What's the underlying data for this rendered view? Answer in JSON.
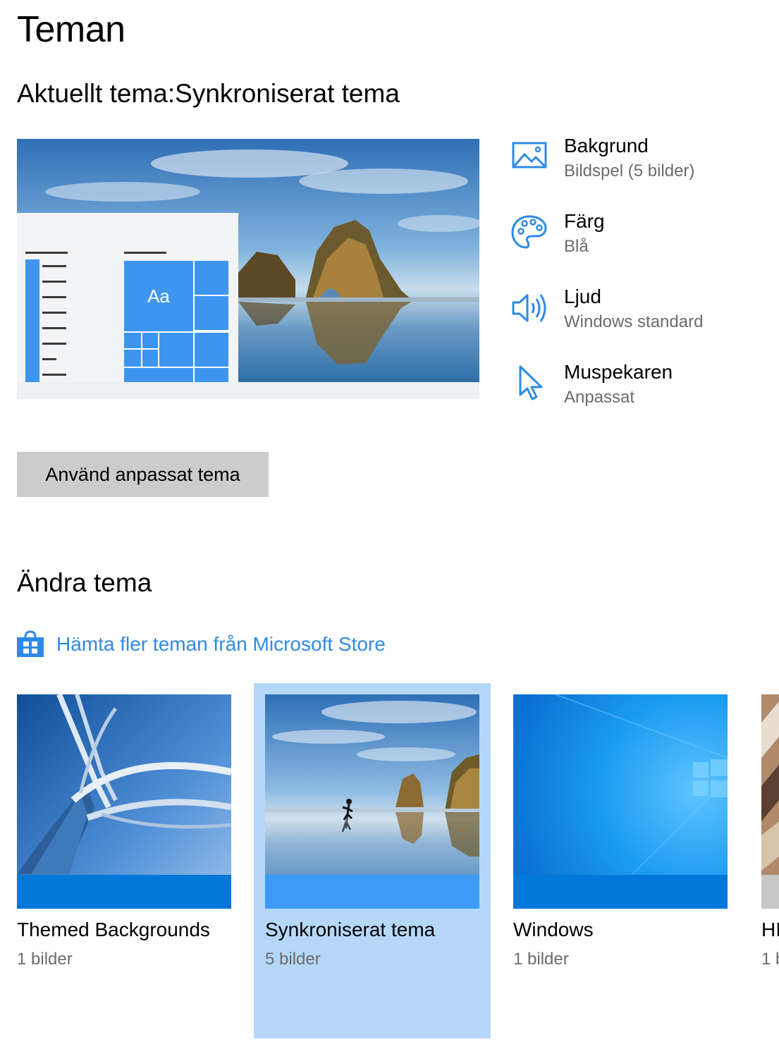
{
  "page": {
    "title": "Teman"
  },
  "current": {
    "heading_prefix": "Aktuellt tema:",
    "heading_name": "Synkroniserat tema",
    "preview_tile_text": "Aa"
  },
  "properties": [
    {
      "title": "Bakgrund",
      "value": "Bildspel (5 bilder)",
      "icon": "picture-icon"
    },
    {
      "title": "Färg",
      "value": "Blå",
      "icon": "palette-icon"
    },
    {
      "title": "Ljud",
      "value": "Windows standard",
      "icon": "speaker-icon"
    },
    {
      "title": "Muspekaren",
      "value": "Anpassat",
      "icon": "cursor-icon"
    }
  ],
  "apply_button": {
    "label": "Använd anpassat tema"
  },
  "change": {
    "heading": "Ändra tema",
    "store_link": "Hämta fler teman från Microsoft Store"
  },
  "themes": [
    {
      "name": "Themed Backgrounds",
      "count": "1 bilder",
      "accent": "#0078d7",
      "selected": false
    },
    {
      "name": "Synkroniserat tema",
      "count": "5 bilder",
      "accent": "#3d9bf5",
      "selected": true
    },
    {
      "name": "Windows",
      "count": "1 bilder",
      "accent": "#0078d7",
      "selected": false
    },
    {
      "name": "HI",
      "count": "1 b",
      "accent": "#c8c8c8",
      "selected": false
    }
  ],
  "colors": {
    "accent": "#2e8ae6",
    "tile_blue": "#3d95ef",
    "selected_bg": "#b5d8f9"
  }
}
